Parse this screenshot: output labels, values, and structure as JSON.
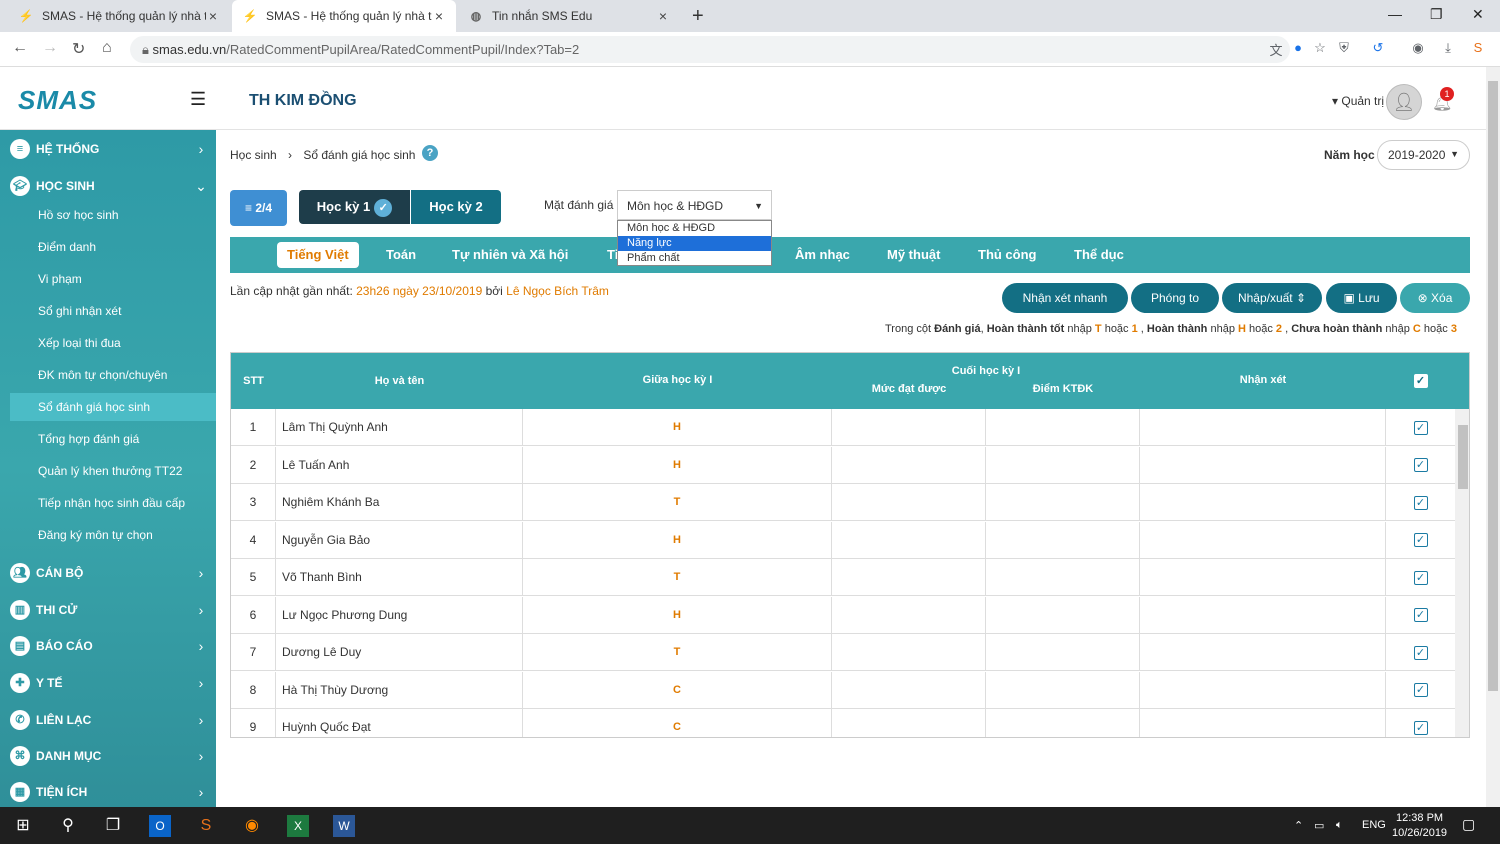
{
  "browser": {
    "tabs": [
      {
        "title": "SMAS - Hệ thống quản lý nhà trư",
        "close": "×"
      },
      {
        "title": "SMAS - Hệ thống quản lý nhà trư",
        "close": "×"
      },
      {
        "title": "Tin nhắn SMS Edu",
        "close": "×"
      }
    ],
    "new_tab": "+",
    "url_host": "smas.edu.vn",
    "url_path": "/RatedCommentPupilArea/RatedCommentPupil/Index?Tab=2"
  },
  "header": {
    "logo": "SMAS",
    "school": "TH KIM ĐỒNG",
    "admin": "▾ Quản trị",
    "bell_count": "1"
  },
  "sidebar": {
    "sections_top": [
      {
        "label": "HỆ THỐNG",
        "chevron": "›"
      },
      {
        "label": "HỌC SINH",
        "chevron": "⌄"
      }
    ],
    "sub_items": [
      "Hồ sơ học sinh",
      "Điểm danh",
      "Vi phạm",
      "Sổ ghi nhận xét",
      "Xếp loại thi đua",
      "ĐK môn tự chọn/chuyên",
      "Sổ đánh giá học sinh",
      "Tổng hợp đánh giá",
      "Quản lý khen thưởng TT22",
      "Tiếp nhận học sinh đầu cấp",
      "Đăng ký môn tự chọn"
    ],
    "selected_sub": "Sổ đánh giá học sinh",
    "sections_bottom": [
      {
        "label": "CÁN BỘ",
        "chevron": "›"
      },
      {
        "label": "THI CỬ",
        "chevron": "›"
      },
      {
        "label": "BÁO CÁO",
        "chevron": "›"
      },
      {
        "label": "Y TẾ",
        "chevron": "›"
      },
      {
        "label": "LIÊN LẠC",
        "chevron": "›"
      },
      {
        "label": "DANH MỤC",
        "chevron": "›"
      },
      {
        "label": "TIỆN ÍCH",
        "chevron": "›"
      }
    ]
  },
  "breadcrumb": {
    "item1": "Học sinh",
    "sep": "›",
    "item2": "Sổ đánh giá học sinh"
  },
  "year": {
    "label": "Năm học",
    "value": "2019-2020"
  },
  "controls": {
    "page_btn": "≡ 2/4",
    "term1": "Học kỳ 1",
    "term2": "Học kỳ 2",
    "aspect_label": "Mặt đánh giá",
    "aspect_value": "Môn học & HĐGD",
    "aspect_options": [
      "Môn học & HĐGD",
      "Năng lực",
      "Phẩm chất"
    ],
    "aspect_highlight": "Năng lực"
  },
  "subjects": [
    "Tiếng Việt",
    "Toán",
    "Tự nhiên và Xã hội",
    "Ti",
    "Âm nhạc",
    "Mỹ thuật",
    "Thủ công",
    "Thể dục"
  ],
  "active_subject": "Tiếng Việt",
  "update": {
    "prefix": "Lần cập nhật gần nhất:",
    "time": "23h26 ngày 23/10/2019",
    "by": "bởi",
    "user": "Lê Ngọc Bích Trâm"
  },
  "actions": {
    "quick": "Nhận xét nhanh",
    "zoom": "Phóng to",
    "io": "Nhập/xuất",
    "save": "Lưu",
    "delete": "Xóa"
  },
  "note": {
    "p1": "Trong cột ",
    "b1": "Đánh giá",
    "p2": ", ",
    "b2": "Hoàn thành tốt",
    "p3": " nhập ",
    "o1": "T",
    "p4": " hoặc ",
    "o2": "1",
    "p5": " , ",
    "b3": "Hoàn thành",
    "p6": " nhập ",
    "o3": "H",
    "p7": " hoặc ",
    "o4": "2",
    "p8": " , ",
    "b4": "Chưa hoàn thành",
    "p9": " nhập ",
    "o5": "C",
    "p10": " hoặc ",
    "o6": "3"
  },
  "table": {
    "headers": {
      "stt": "STT",
      "name": "Họ và tên",
      "mid": "Giữa học kỳ I",
      "end": "Cuối học kỳ I",
      "level": "Mức đạt được",
      "score": "Điểm KTĐK",
      "comment": "Nhận xét"
    },
    "rows": [
      {
        "stt": "1",
        "name": "Lâm Thị Quỳnh Anh",
        "mid": "H"
      },
      {
        "stt": "2",
        "name": "Lê Tuấn Anh",
        "mid": "H"
      },
      {
        "stt": "3",
        "name": "Nghiêm Khánh Ba",
        "mid": "T"
      },
      {
        "stt": "4",
        "name": "Nguyễn Gia Bảo",
        "mid": "H"
      },
      {
        "stt": "5",
        "name": "Võ Thanh Bình",
        "mid": "T"
      },
      {
        "stt": "6",
        "name": "Lư Ngọc Phương Dung",
        "mid": "H"
      },
      {
        "stt": "7",
        "name": "Dương Lê Duy",
        "mid": "T"
      },
      {
        "stt": "8",
        "name": "Hà Thị Thùy Dương",
        "mid": "C"
      },
      {
        "stt": "9",
        "name": "Huỳnh Quốc Đạt",
        "mid": "C"
      }
    ]
  },
  "taskbar": {
    "lang": "ENG",
    "time": "12:38 PM",
    "date": "10/26/2019"
  }
}
